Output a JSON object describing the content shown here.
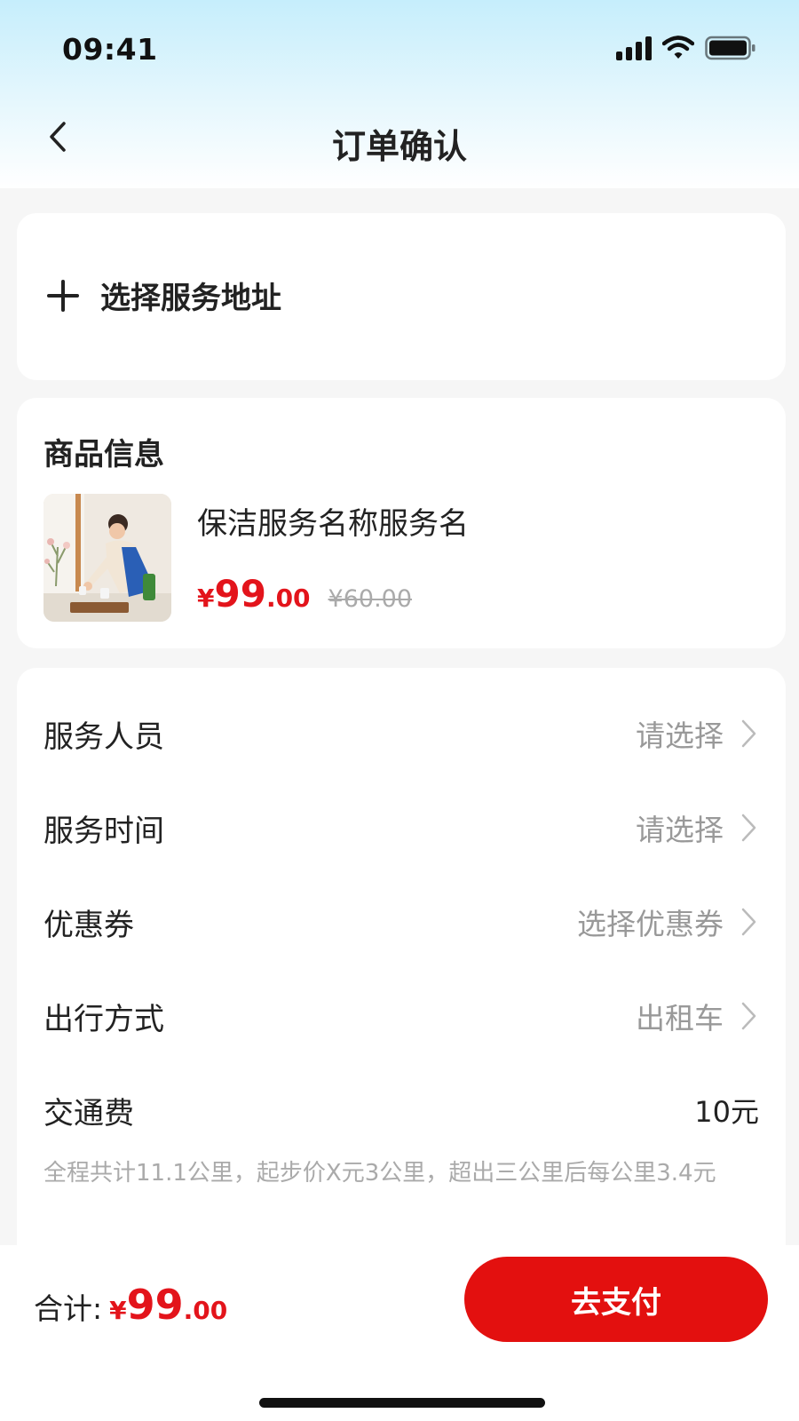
{
  "status_bar": {
    "time": "09:41"
  },
  "nav": {
    "title": "订单确认"
  },
  "address": {
    "label": "选择服务地址"
  },
  "product": {
    "section_title": "商品信息",
    "name": "保洁服务名称服务名",
    "price": {
      "symbol": "¥",
      "integer": "99",
      "decimal": ".00"
    },
    "original_price": "¥60.00"
  },
  "options": {
    "staff": {
      "label": "服务人员",
      "value": "请选择"
    },
    "time": {
      "label": "服务时间",
      "value": "请选择"
    },
    "coupon": {
      "label": "优惠券",
      "value": "选择优惠券"
    },
    "travel": {
      "label": "出行方式",
      "value": "出租车"
    },
    "fare": {
      "label": "交通费",
      "value": "10元",
      "description": "全程共计11.1公里，起步价X元3公里，超出三公里后每公里3.4元"
    }
  },
  "bottom_bar": {
    "total_label": "合计:",
    "total_price": {
      "symbol": "¥",
      "integer": "99",
      "decimal": ".00"
    },
    "pay_label": "去支付"
  },
  "colors": {
    "accent": "#e3141b",
    "pay_button": "#e3100f",
    "header_gradient_top": "#c6eefc",
    "muted_text": "#999999"
  },
  "icons": {
    "status": [
      "signal-icon",
      "wifi-icon",
      "battery-icon"
    ],
    "back": "chevron-left-icon",
    "add": "plus-icon",
    "row_arrow": "chevron-right-icon"
  }
}
